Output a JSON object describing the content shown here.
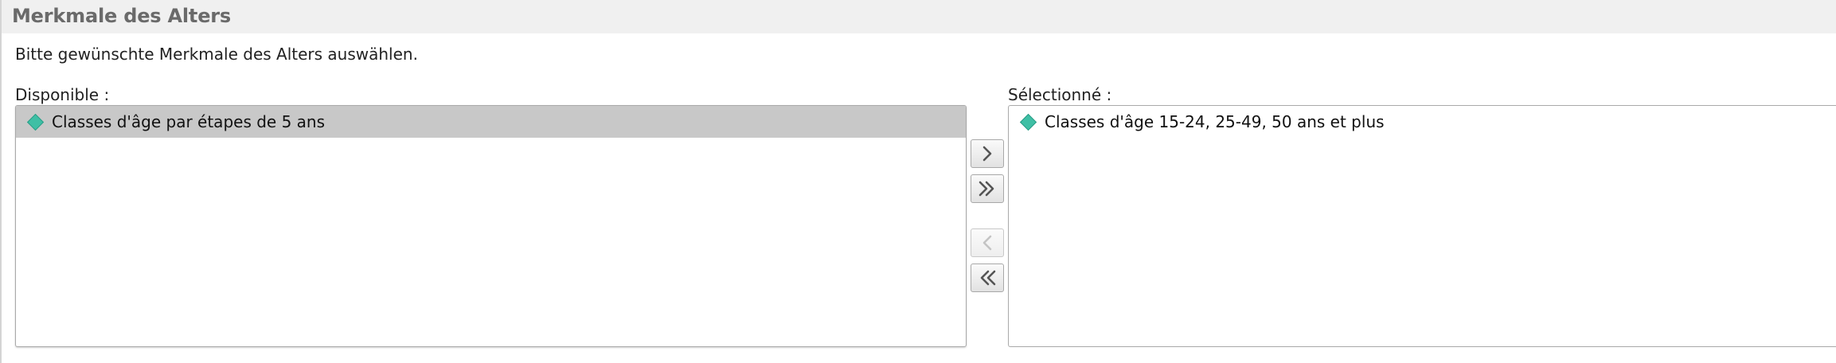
{
  "panel": {
    "title": "Merkmale des Alters",
    "instruction": "Bitte gewünschte Merkmale des Alters auswählen."
  },
  "available": {
    "label": "Disponible :",
    "items": [
      {
        "label": "Classes d'âge par étapes de 5 ans",
        "icon": "diamond-icon",
        "highlighted": true
      }
    ]
  },
  "selected": {
    "label": "Sélectionné :",
    "items": [
      {
        "label": "Classes d'âge 15-24, 25-49, 50 ans et plus",
        "icon": "diamond-icon",
        "highlighted": false
      }
    ]
  },
  "buttons": {
    "add": {
      "icon": "chevron-right-icon",
      "enabled": true
    },
    "add_all": {
      "icon": "double-chevron-right-icon",
      "enabled": true
    },
    "remove": {
      "icon": "chevron-left-icon",
      "enabled": false
    },
    "remove_all": {
      "icon": "double-chevron-left-icon",
      "enabled": true
    }
  },
  "colors": {
    "item_icon": "#3fbfa5",
    "highlight_row": "#c8c8c8",
    "header_bg": "#f0f0f0",
    "title_text": "#6a6a6a"
  }
}
